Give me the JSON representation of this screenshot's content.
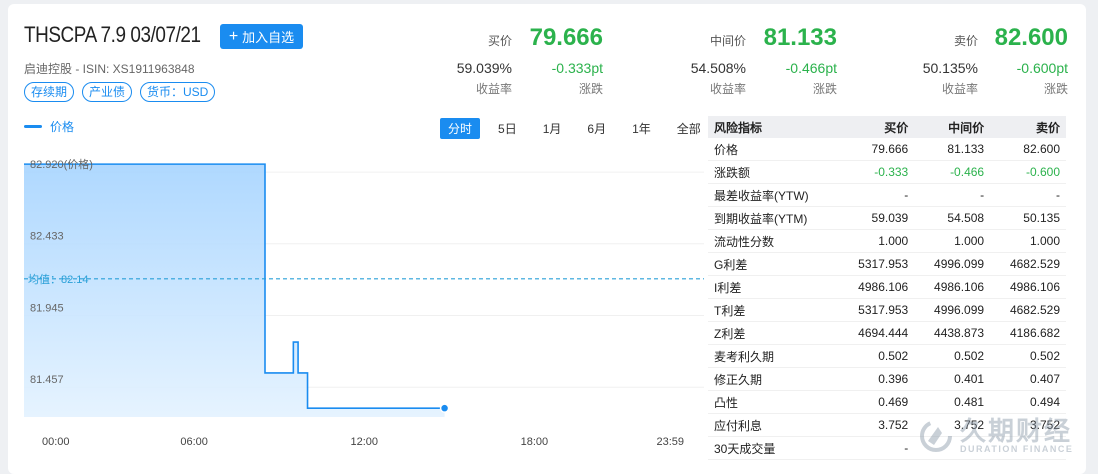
{
  "header": {
    "title": "THSCPA 7.9 03/07/21",
    "add_button": "加入自选",
    "issuer_line": "启迪控股 - ISIN: XS1911963848",
    "tags": [
      "存续期",
      "产业债",
      "货币：USD"
    ]
  },
  "quotes": {
    "bid": {
      "label": "买价",
      "price": "79.666",
      "yield": "59.039%",
      "change": "-0.333pt",
      "yield_label": "收益率",
      "change_label": "涨跌"
    },
    "mid": {
      "label": "中间价",
      "price": "81.133",
      "yield": "54.508%",
      "change": "-0.466pt",
      "yield_label": "收益率",
      "change_label": "涨跌"
    },
    "ask": {
      "label": "卖价",
      "price": "82.600",
      "yield": "50.135%",
      "change": "-0.600pt",
      "yield_label": "收益率",
      "change_label": "涨跌"
    }
  },
  "chart_panel": {
    "legend": "价格",
    "ranges": [
      "分时",
      "5日",
      "1月",
      "6月",
      "1年",
      "全部"
    ],
    "active_range": "分时"
  },
  "chart_data": {
    "type": "area",
    "series": [
      {
        "name": "价格",
        "x": [
          "00:00",
          "08:30",
          "08:30",
          "09:30",
          "09:30",
          "09:40",
          "09:40",
          "10:00",
          "10:00",
          "14:50"
        ],
        "y": [
          82.92,
          82.92,
          81.5,
          81.5,
          81.71,
          81.71,
          81.5,
          81.5,
          81.26,
          81.26
        ]
      }
    ],
    "x_ticks": [
      "00:00",
      "06:00",
      "12:00",
      "18:00",
      "23:59"
    ],
    "y_ticks": [
      "82.920(价格)",
      "82.433",
      "81.945",
      "81.457"
    ],
    "y_tick_values": [
      82.92,
      82.433,
      81.945,
      81.457
    ],
    "average": 82.14,
    "average_label": "均值：82.14",
    "ylim": [
      81.2,
      83.05
    ],
    "colors": {
      "line": "#1a8cf0",
      "fill_top": "#a6d4ff",
      "fill_bottom": "#e3f2ff"
    }
  },
  "risk_table": {
    "headers": [
      "风险指标",
      "买价",
      "中间价",
      "卖价"
    ],
    "rows": [
      {
        "label": "价格",
        "values": [
          "79.666",
          "81.133",
          "82.600"
        ],
        "neg": false
      },
      {
        "label": "涨跌额",
        "values": [
          "-0.333",
          "-0.466",
          "-0.600"
        ],
        "neg": true
      },
      {
        "label": "最差收益率(YTW)",
        "values": [
          "-",
          "-",
          "-"
        ],
        "neg": false
      },
      {
        "label": "到期收益率(YTM)",
        "values": [
          "59.039",
          "54.508",
          "50.135"
        ],
        "neg": false
      },
      {
        "label": "流动性分数",
        "values": [
          "1.000",
          "1.000",
          "1.000"
        ],
        "neg": false
      },
      {
        "label": "G利差",
        "values": [
          "5317.953",
          "4996.099",
          "4682.529"
        ],
        "neg": false
      },
      {
        "label": "I利差",
        "values": [
          "4986.106",
          "4986.106",
          "4986.106"
        ],
        "neg": false
      },
      {
        "label": "T利差",
        "values": [
          "5317.953",
          "4996.099",
          "4682.529"
        ],
        "neg": false
      },
      {
        "label": "Z利差",
        "values": [
          "4694.444",
          "4438.873",
          "4186.682"
        ],
        "neg": false
      },
      {
        "label": "麦考利久期",
        "values": [
          "0.502",
          "0.502",
          "0.502"
        ],
        "neg": false
      },
      {
        "label": "修正久期",
        "values": [
          "0.396",
          "0.401",
          "0.407"
        ],
        "neg": false
      },
      {
        "label": "凸性",
        "values": [
          "0.469",
          "0.481",
          "0.494"
        ],
        "neg": false
      },
      {
        "label": "应付利息",
        "values": [
          "3.752",
          "3.752",
          "3.752"
        ],
        "neg": false
      },
      {
        "label": "30天成交量",
        "values": [
          "-",
          "",
          ""
        ],
        "neg": false
      }
    ]
  },
  "watermark": {
    "text": "久期财经",
    "sub": "DURATION FINANCE"
  },
  "icons": {
    "add": "plus-icon"
  }
}
